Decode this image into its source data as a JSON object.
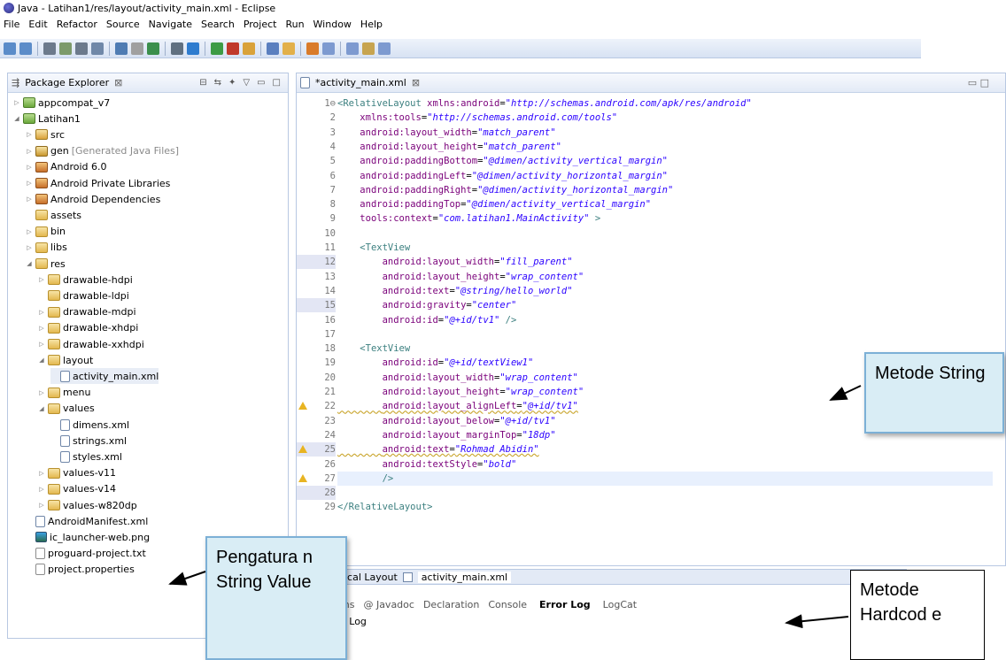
{
  "window": {
    "title": "Java - Latihan1/res/layout/activity_main.xml - Eclipse"
  },
  "menu": [
    "File",
    "Edit",
    "Refactor",
    "Source",
    "Navigate",
    "Search",
    "Project",
    "Run",
    "Window",
    "Help"
  ],
  "package_explorer": {
    "title": "Package Explorer",
    "tree": [
      {
        "label": "appcompat_v7",
        "depth": 0,
        "twisty": "▷",
        "icon": "project"
      },
      {
        "label": "Latihan1",
        "depth": 0,
        "twisty": "◢",
        "icon": "project"
      },
      {
        "label": "src",
        "depth": 1,
        "twisty": "▷",
        "icon": "pkgfolder"
      },
      {
        "label": "gen",
        "extra": "[Generated Java Files]",
        "depth": 1,
        "twisty": "▷",
        "icon": "gen"
      },
      {
        "label": "Android 6.0",
        "depth": 1,
        "twisty": "▷",
        "icon": "lib"
      },
      {
        "label": "Android Private Libraries",
        "depth": 1,
        "twisty": "▷",
        "icon": "lib"
      },
      {
        "label": "Android Dependencies",
        "depth": 1,
        "twisty": "▷",
        "icon": "lib"
      },
      {
        "label": "assets",
        "depth": 1,
        "twisty": "",
        "icon": "folder"
      },
      {
        "label": "bin",
        "depth": 1,
        "twisty": "▷",
        "icon": "folder"
      },
      {
        "label": "libs",
        "depth": 1,
        "twisty": "▷",
        "icon": "folder"
      },
      {
        "label": "res",
        "depth": 1,
        "twisty": "◢",
        "icon": "folder"
      },
      {
        "label": "drawable-hdpi",
        "depth": 2,
        "twisty": "▷",
        "icon": "folder"
      },
      {
        "label": "drawable-ldpi",
        "depth": 2,
        "twisty": "",
        "icon": "folder"
      },
      {
        "label": "drawable-mdpi",
        "depth": 2,
        "twisty": "▷",
        "icon": "folder"
      },
      {
        "label": "drawable-xhdpi",
        "depth": 2,
        "twisty": "▷",
        "icon": "folder"
      },
      {
        "label": "drawable-xxhdpi",
        "depth": 2,
        "twisty": "▷",
        "icon": "folder"
      },
      {
        "label": "layout",
        "depth": 2,
        "twisty": "◢",
        "icon": "folder"
      },
      {
        "label": "activity_main.xml",
        "depth": 3,
        "twisty": "",
        "icon": "xml",
        "selected": true
      },
      {
        "label": "menu",
        "depth": 2,
        "twisty": "▷",
        "icon": "folder"
      },
      {
        "label": "values",
        "depth": 2,
        "twisty": "◢",
        "icon": "folder"
      },
      {
        "label": "dimens.xml",
        "depth": 3,
        "twisty": "",
        "icon": "xml"
      },
      {
        "label": "strings.xml",
        "depth": 3,
        "twisty": "",
        "icon": "xml"
      },
      {
        "label": "styles.xml",
        "depth": 3,
        "twisty": "",
        "icon": "xml"
      },
      {
        "label": "values-v11",
        "depth": 2,
        "twisty": "▷",
        "icon": "folder"
      },
      {
        "label": "values-v14",
        "depth": 2,
        "twisty": "▷",
        "icon": "folder"
      },
      {
        "label": "values-w820dp",
        "depth": 2,
        "twisty": "▷",
        "icon": "folder"
      },
      {
        "label": "AndroidManifest.xml",
        "depth": 1,
        "twisty": "",
        "icon": "xml"
      },
      {
        "label": "ic_launcher-web.png",
        "depth": 1,
        "twisty": "",
        "icon": "png"
      },
      {
        "label": "proguard-project.txt",
        "depth": 1,
        "twisty": "",
        "icon": "file"
      },
      {
        "label": "project.properties",
        "depth": 1,
        "twisty": "",
        "icon": "file"
      }
    ]
  },
  "editor": {
    "tab_label": "*activity_main.xml",
    "lines": [
      {
        "n": "1",
        "text": "<RelativeLayout xmlns:android=\"http://schemas.android.com/apk/res/android\"",
        "fold": true
      },
      {
        "n": "2",
        "text": "    xmlns:tools=\"http://schemas.android.com/tools\""
      },
      {
        "n": "3",
        "text": "    android:layout_width=\"match_parent\""
      },
      {
        "n": "4",
        "text": "    android:layout_height=\"match_parent\""
      },
      {
        "n": "5",
        "text": "    android:paddingBottom=\"@dimen/activity_vertical_margin\""
      },
      {
        "n": "6",
        "text": "    android:paddingLeft=\"@dimen/activity_horizontal_margin\""
      },
      {
        "n": "7",
        "text": "    android:paddingRight=\"@dimen/activity_horizontal_margin\""
      },
      {
        "n": "8",
        "text": "    android:paddingTop=\"@dimen/activity_vertical_margin\""
      },
      {
        "n": "9",
        "text": "    tools:context=\"com.latihan1.MainActivity\" >"
      },
      {
        "n": "10",
        "text": ""
      },
      {
        "n": "11",
        "text": "    <TextView"
      },
      {
        "n": "12",
        "text": "        android:layout_width=\"fill_parent\"",
        "hl": true
      },
      {
        "n": "13",
        "text": "        android:layout_height=\"wrap_content\""
      },
      {
        "n": "14",
        "text": "        android:text=\"@string/hello_world\""
      },
      {
        "n": "15",
        "text": "        android:gravity=\"center\"",
        "hl": true
      },
      {
        "n": "16",
        "text": "        android:id=\"@+id/tv1\" />"
      },
      {
        "n": "17",
        "text": ""
      },
      {
        "n": "18",
        "text": "    <TextView"
      },
      {
        "n": "19",
        "text": "        android:id=\"@+id/textView1\""
      },
      {
        "n": "20",
        "text": "        android:layout_width=\"wrap_content\""
      },
      {
        "n": "21",
        "text": "        android:layout_height=\"wrap_content\""
      },
      {
        "n": "22",
        "text": "        android:layout_alignLeft=\"@+id/tv1\"",
        "warn": true,
        "uw": true
      },
      {
        "n": "23",
        "text": "        android:layout_below=\"@+id/tv1\""
      },
      {
        "n": "24",
        "text": "        android:layout_marginTop=\"18dp\""
      },
      {
        "n": "25",
        "text": "        android:text=\"Rohmad Abidin\"",
        "warn": true,
        "uw": true,
        "hl": true
      },
      {
        "n": "26",
        "text": "        android:textStyle=\"bold\""
      },
      {
        "n": "27",
        "text": "        />",
        "warn": true,
        "current": true
      },
      {
        "n": "28",
        "text": "",
        "hl": true
      },
      {
        "n": "29",
        "text": "</RelativeLayout>"
      }
    ]
  },
  "bottom": {
    "editor_tab_1": "ical Layout",
    "editor_tab_2": "activity_main.xml",
    "views": [
      "ms",
      "@ Javadoc",
      "Declaration",
      "Console",
      "Error Log",
      "LogCat"
    ],
    "subtitle": "e Log"
  },
  "annotations": {
    "metode_string": "Metode String",
    "pengaturan": "Pengatura n String Value",
    "hardcode": "Metode Hardcod e"
  },
  "colors": {
    "toolbar": "#d7e2f3",
    "callout_fill": "#d9edf5",
    "callout_border": "#7cb0d6"
  }
}
